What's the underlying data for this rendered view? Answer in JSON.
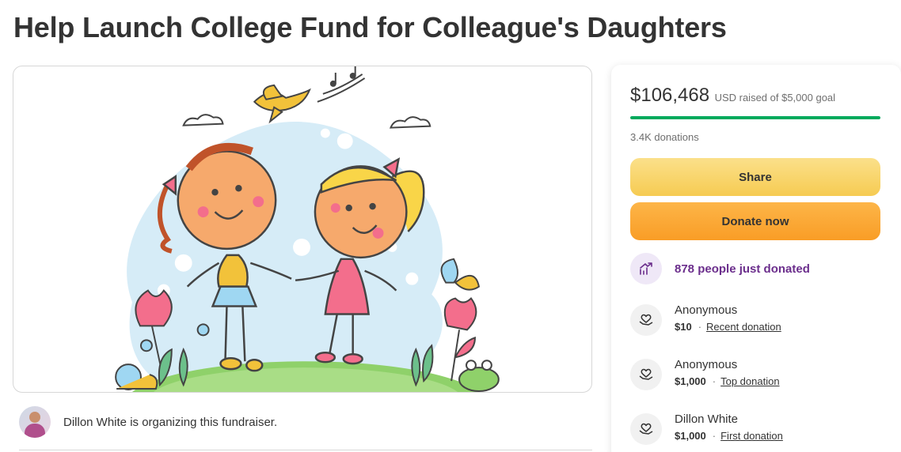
{
  "page": {
    "title": "Help Launch College Fund for Colleague's Daughters"
  },
  "hero_image": {
    "description_icon": "illustration-two-girls-holding-hands"
  },
  "organizer": {
    "text": "Dillon White is organizing this fundraiser."
  },
  "fundraiser": {
    "amount_raised": "$106,468",
    "goal_text": "USD raised of $5,000 goal",
    "progress_fraction": 1.0,
    "donations_count": "3.4K donations",
    "share_label": "Share",
    "donate_label": "Donate now",
    "trend_text": "878 people just donated"
  },
  "donations": [
    {
      "name": "Anonymous",
      "amount": "$10",
      "tag": "Recent donation"
    },
    {
      "name": "Anonymous",
      "amount": "$1,000",
      "tag": "Top donation"
    },
    {
      "name": "Dillon White",
      "amount": "$1,000",
      "tag": "First donation"
    }
  ],
  "colors": {
    "progress_green": "#02a95c",
    "share_yellow": "#f6cb52",
    "donate_orange": "#f99d26",
    "trend_purple": "#6b2e8c"
  },
  "icons": {
    "trend": "trending-up-icon",
    "donor": "heart-hand-icon"
  }
}
